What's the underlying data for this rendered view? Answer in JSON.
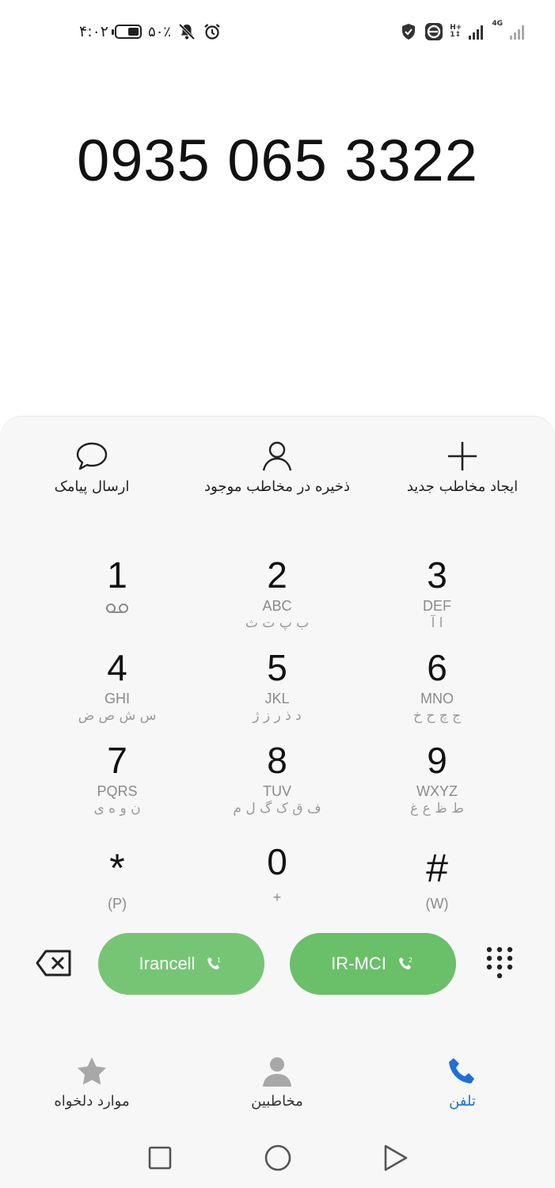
{
  "status_bar": {
    "time": "۴:۰۲",
    "battery_percent": "۵۰٪",
    "battery_level": 0.5,
    "icons": [
      "alarm-icon",
      "bell-off-icon",
      "shield-icon",
      "e-icon",
      "signal-icon"
    ],
    "sim1_tag_top": "H+",
    "sim1_tag_bottom": "1↕",
    "sim2_tag": "4G"
  },
  "dialed_number": "0935 065 3322",
  "actions": {
    "create_contact": "ایجاد مخاطب جدید",
    "save_existing": "ذخیره در مخاطب موجود",
    "send_sms": "ارسال پیامک"
  },
  "keypad": [
    {
      "digit": "1",
      "letters": "",
      "fa": ""
    },
    {
      "digit": "2",
      "letters": "ABC",
      "fa": "ب پ ت ث"
    },
    {
      "digit": "3",
      "letters": "DEF",
      "fa": "ا آ"
    },
    {
      "digit": "4",
      "letters": "GHI",
      "fa": "س ش ص ض"
    },
    {
      "digit": "5",
      "letters": "JKL",
      "fa": "د ذ ر ز ژ"
    },
    {
      "digit": "6",
      "letters": "MNO",
      "fa": "ج چ ح خ"
    },
    {
      "digit": "7",
      "letters": "PQRS",
      "fa": "ن و ه ی"
    },
    {
      "digit": "8",
      "letters": "TUV",
      "fa": "ف ق ک گ ل م"
    },
    {
      "digit": "9",
      "letters": "WXYZ",
      "fa": "ط ظ ع غ"
    },
    {
      "digit": "*",
      "letters": "(P)",
      "fa": ""
    },
    {
      "digit": "0",
      "letters": "+",
      "fa": ""
    },
    {
      "digit": "#",
      "letters": "(W)",
      "fa": ""
    }
  ],
  "call_buttons": {
    "sim1": "Irancell",
    "sim2": "IR-MCI"
  },
  "bottom_nav": {
    "favorites": "موارد دلخواه",
    "contacts": "مخاطبین",
    "phone": "تلفن"
  },
  "colors": {
    "call_green": "#6abf69",
    "active_blue": "#1f6fd6"
  }
}
